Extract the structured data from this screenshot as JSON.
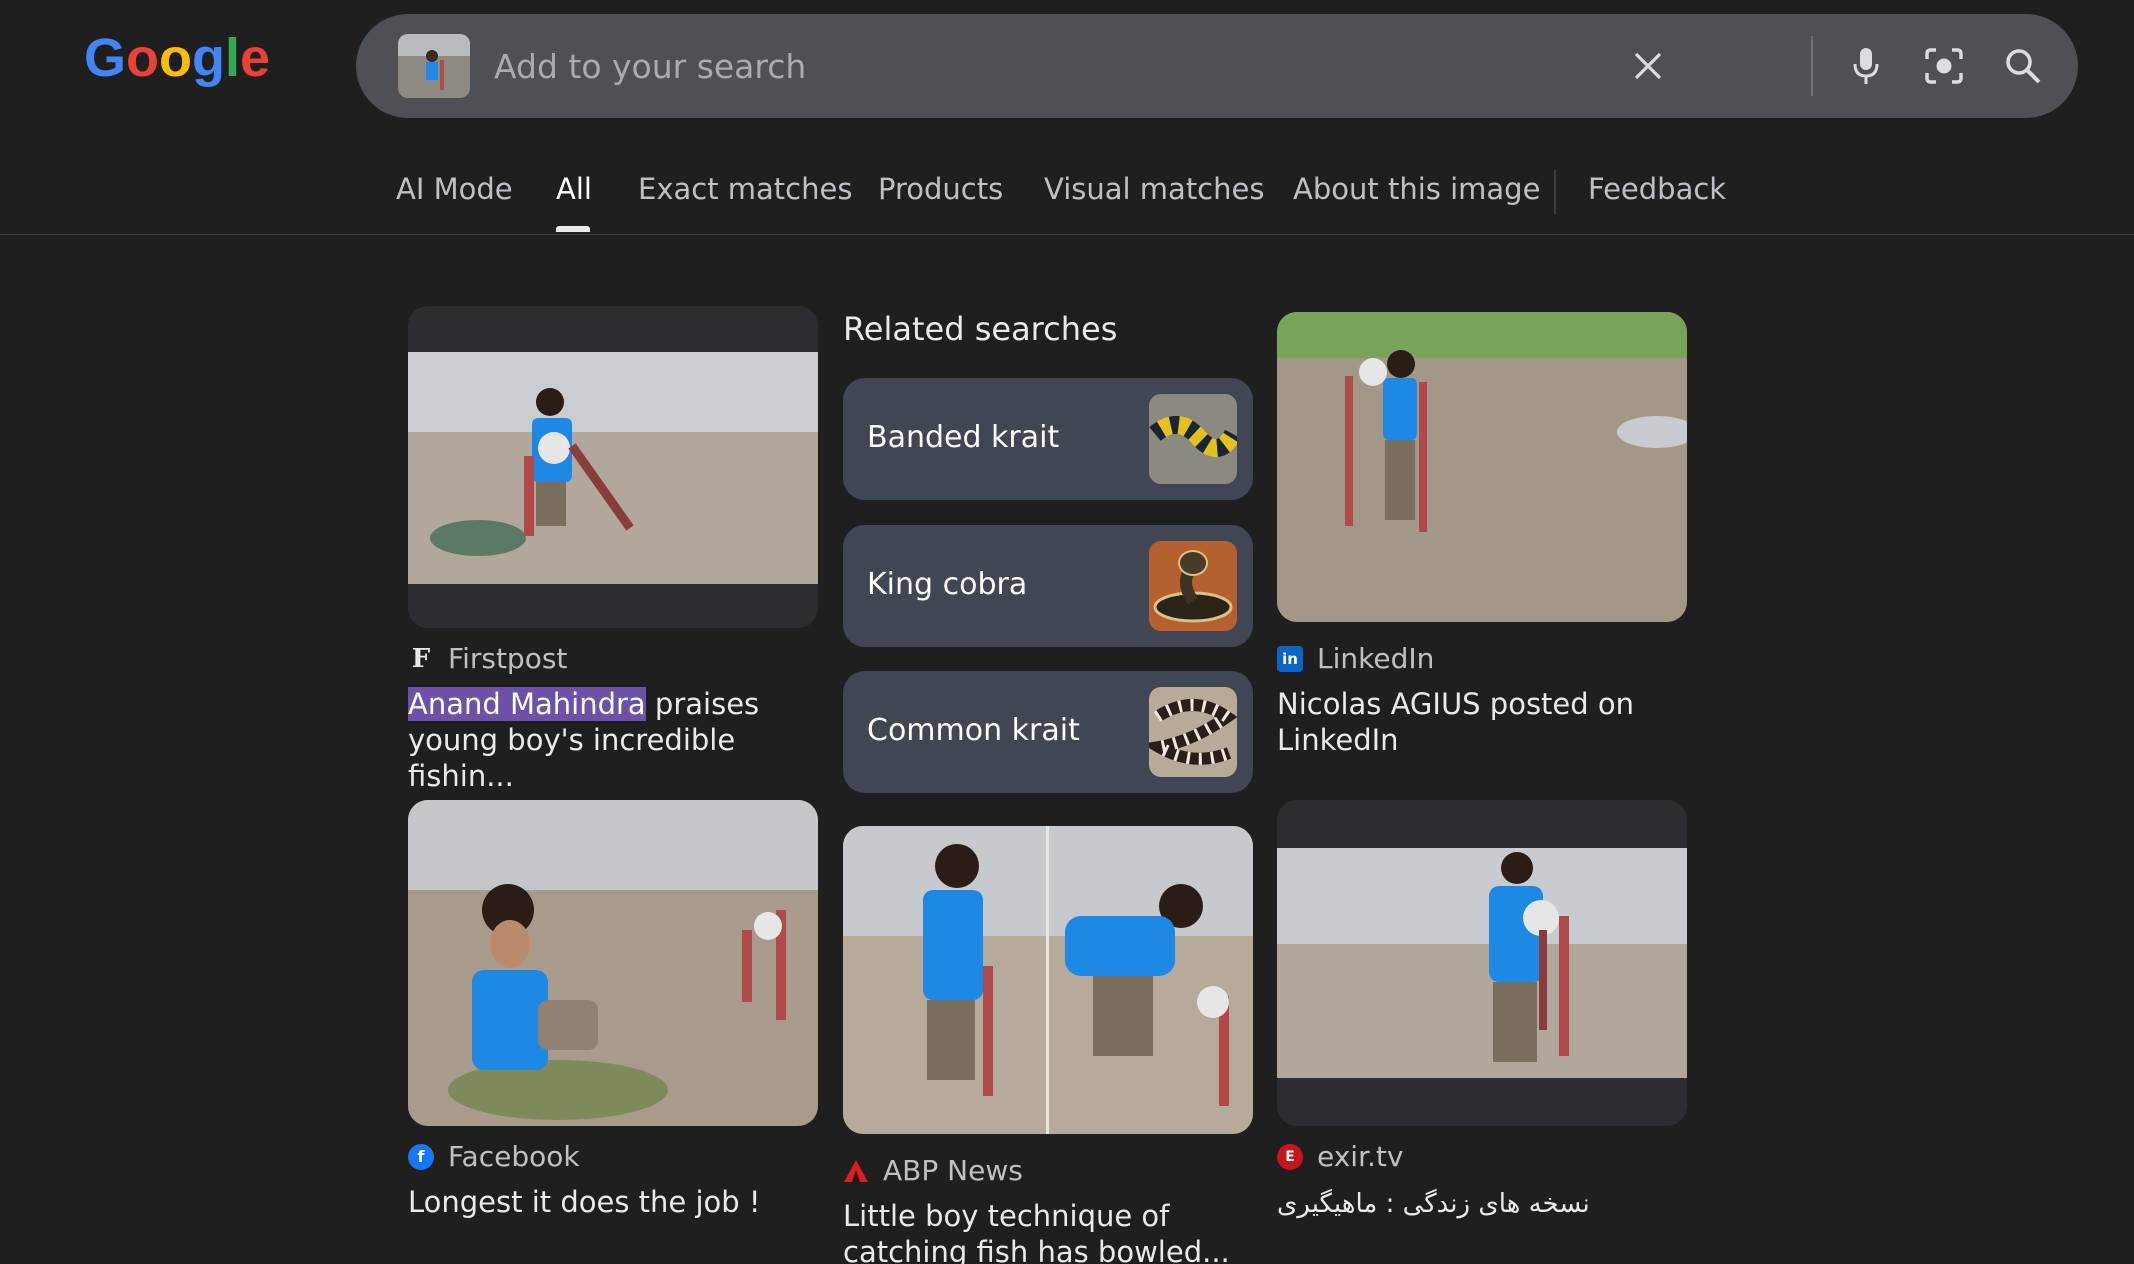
{
  "header": {
    "logo_text": "Google",
    "search": {
      "placeholder": "Add to your search",
      "value": "",
      "clear_icon": "close-icon",
      "voice_icon": "microphone-icon",
      "lens_icon": "camera-lens-icon",
      "submit_icon": "search-icon"
    }
  },
  "tabs": [
    {
      "label": "AI Mode",
      "active": false
    },
    {
      "label": "All",
      "active": true
    },
    {
      "label": "Exact matches",
      "active": false
    },
    {
      "label": "Products",
      "active": false
    },
    {
      "label": "Visual matches",
      "active": false
    },
    {
      "label": "About this image",
      "active": false
    },
    {
      "label": "Feedback",
      "active": false
    }
  ],
  "results": {
    "col1": [
      {
        "source": "Firstpost",
        "source_icon": "firstpost-icon",
        "title_highlight": "Anand Mahindra",
        "title_line1_rest": " praises",
        "title_line2": "young boy's incredible fishin..."
      },
      {
        "source": "Facebook",
        "source_icon": "facebook-icon",
        "title": "Longest it does the job !"
      }
    ],
    "col2": [
      {
        "source": "ABP News",
        "source_icon": "abp-news-icon",
        "title_line1": "Little boy technique of",
        "title_line2": "catching fish has bowled..."
      }
    ],
    "col3": [
      {
        "source": "LinkedIn",
        "source_icon": "linkedin-icon",
        "title_line1": "Nicolas AGIUS posted on",
        "title_line2": "LinkedIn"
      },
      {
        "source": "exir.tv",
        "source_icon": "exir-tv-icon",
        "title": "نسخه های زندگی : ماهیگیری"
      }
    ]
  },
  "related": {
    "heading": "Related searches",
    "items": [
      {
        "label": "Banded krait"
      },
      {
        "label": "King cobra"
      },
      {
        "label": "Common krait"
      }
    ]
  },
  "colors": {
    "background": "#1f1f1f",
    "searchbar": "#4d5156",
    "related_card": "#404654",
    "highlight": "#6d51a8"
  }
}
